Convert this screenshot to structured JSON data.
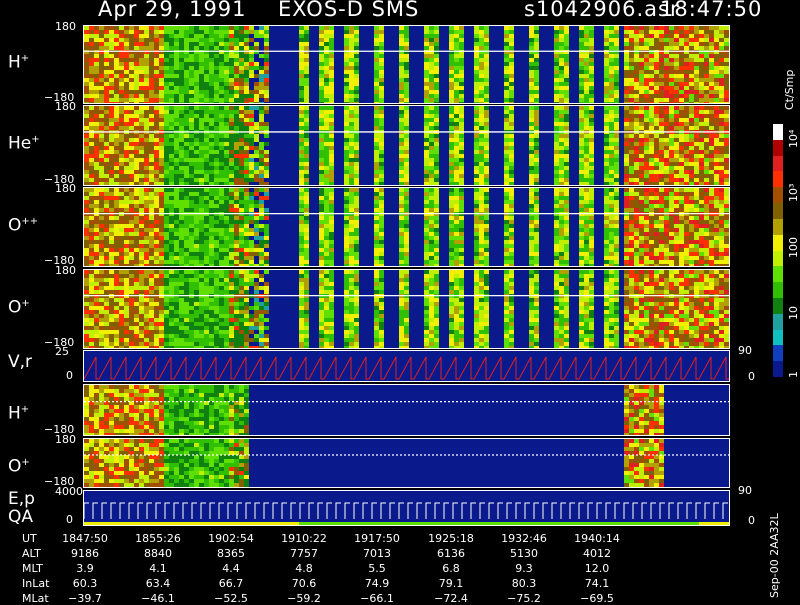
{
  "header": {
    "date": "Apr 29, 1991",
    "instrument": "EXOS-D SMS",
    "file": "s1042906.asr",
    "time": "18:47:50"
  },
  "panels": [
    {
      "label": "H",
      "sup": "+",
      "ytop": "180",
      "ybot": "−180",
      "kind": "spec"
    },
    {
      "label": "He",
      "sup": "+",
      "ytop": "180",
      "ybot": "−180",
      "kind": "spec"
    },
    {
      "label": "O",
      "sup": "++",
      "ytop": "180",
      "ybot": "−180",
      "kind": "spec"
    },
    {
      "label": "O",
      "sup": "+",
      "ytop": "180",
      "ybot": "−180",
      "kind": "spec"
    },
    {
      "label": "V,r",
      "sup": "",
      "ytop": "25",
      "ybot": "0",
      "kind": "line",
      "rtop": "90",
      "rbot": "0"
    },
    {
      "label": "H",
      "sup": "+",
      "ytop": "",
      "ybot": "−180",
      "kind": "spec2"
    },
    {
      "label": "O",
      "sup": "+",
      "ytop": "180",
      "ybot": "−180",
      "kind": "spec2"
    },
    {
      "label": "E,p",
      "sup": "",
      "label2": "QA",
      "ytop": "4000",
      "ybot": "0",
      "kind": "qa",
      "rtop": "90",
      "rbot": "0"
    }
  ],
  "colorbar": {
    "unit": "Ct/Smp",
    "ticks": [
      "10⁴",
      "10³",
      "100",
      "10",
      "1"
    ],
    "colors": [
      "#ffffff",
      "#b00000",
      "#e02020",
      "#ff3000",
      "#a05000",
      "#806000",
      "#b0a000",
      "#f0f000",
      "#c0f000",
      "#60e000",
      "#30c000",
      "#108010",
      "#20a0a0",
      "#10c0c0",
      "#1040c0",
      "#0a1a8c"
    ]
  },
  "ephemeris": {
    "labels": [
      "UT",
      "ALT",
      "MLT",
      "InLat",
      "MLat"
    ],
    "columns": [
      [
        "1847:50",
        "9186",
        "3.9",
        "60.3",
        "−39.7"
      ],
      [
        "1855:26",
        "8840",
        "4.1",
        "63.4",
        "−46.1"
      ],
      [
        "1902:54",
        "8365",
        "4.4",
        "66.7",
        "−52.5"
      ],
      [
        "1910:22",
        "7757",
        "4.8",
        "70.6",
        "−59.2"
      ],
      [
        "1917:50",
        "7013",
        "5.5",
        "74.9",
        "−66.1"
      ],
      [
        "1925:18",
        "6136",
        "6.8",
        "79.1",
        "−72.4"
      ],
      [
        "1932:46",
        "5130",
        "9.3",
        "80.3",
        "−75.2"
      ],
      [
        "1940:14",
        "4012",
        "12.0",
        "74.1",
        "−69.5"
      ]
    ]
  },
  "footer_code": "Sep-00 2AA32L",
  "chart_data": {
    "type": "heatmap",
    "title": "Apr 29, 1991 EXOS-D SMS s1042906.asr 18:47:50",
    "xlabel": "UT",
    "x": [
      "1847:50",
      "1855:26",
      "1902:54",
      "1910:22",
      "1917:50",
      "1925:18",
      "1932:46",
      "1940:14"
    ],
    "ylabel_panels": [
      "H+",
      "He+",
      "O++",
      "O+",
      "V,r",
      "H+",
      "O+",
      "E,p QA"
    ],
    "ylim": [
      -180,
      180
    ],
    "colorbar_unit": "Ct/Smp",
    "colorbar_range": [
      1,
      10000
    ],
    "colorbar_scale": "log"
  }
}
